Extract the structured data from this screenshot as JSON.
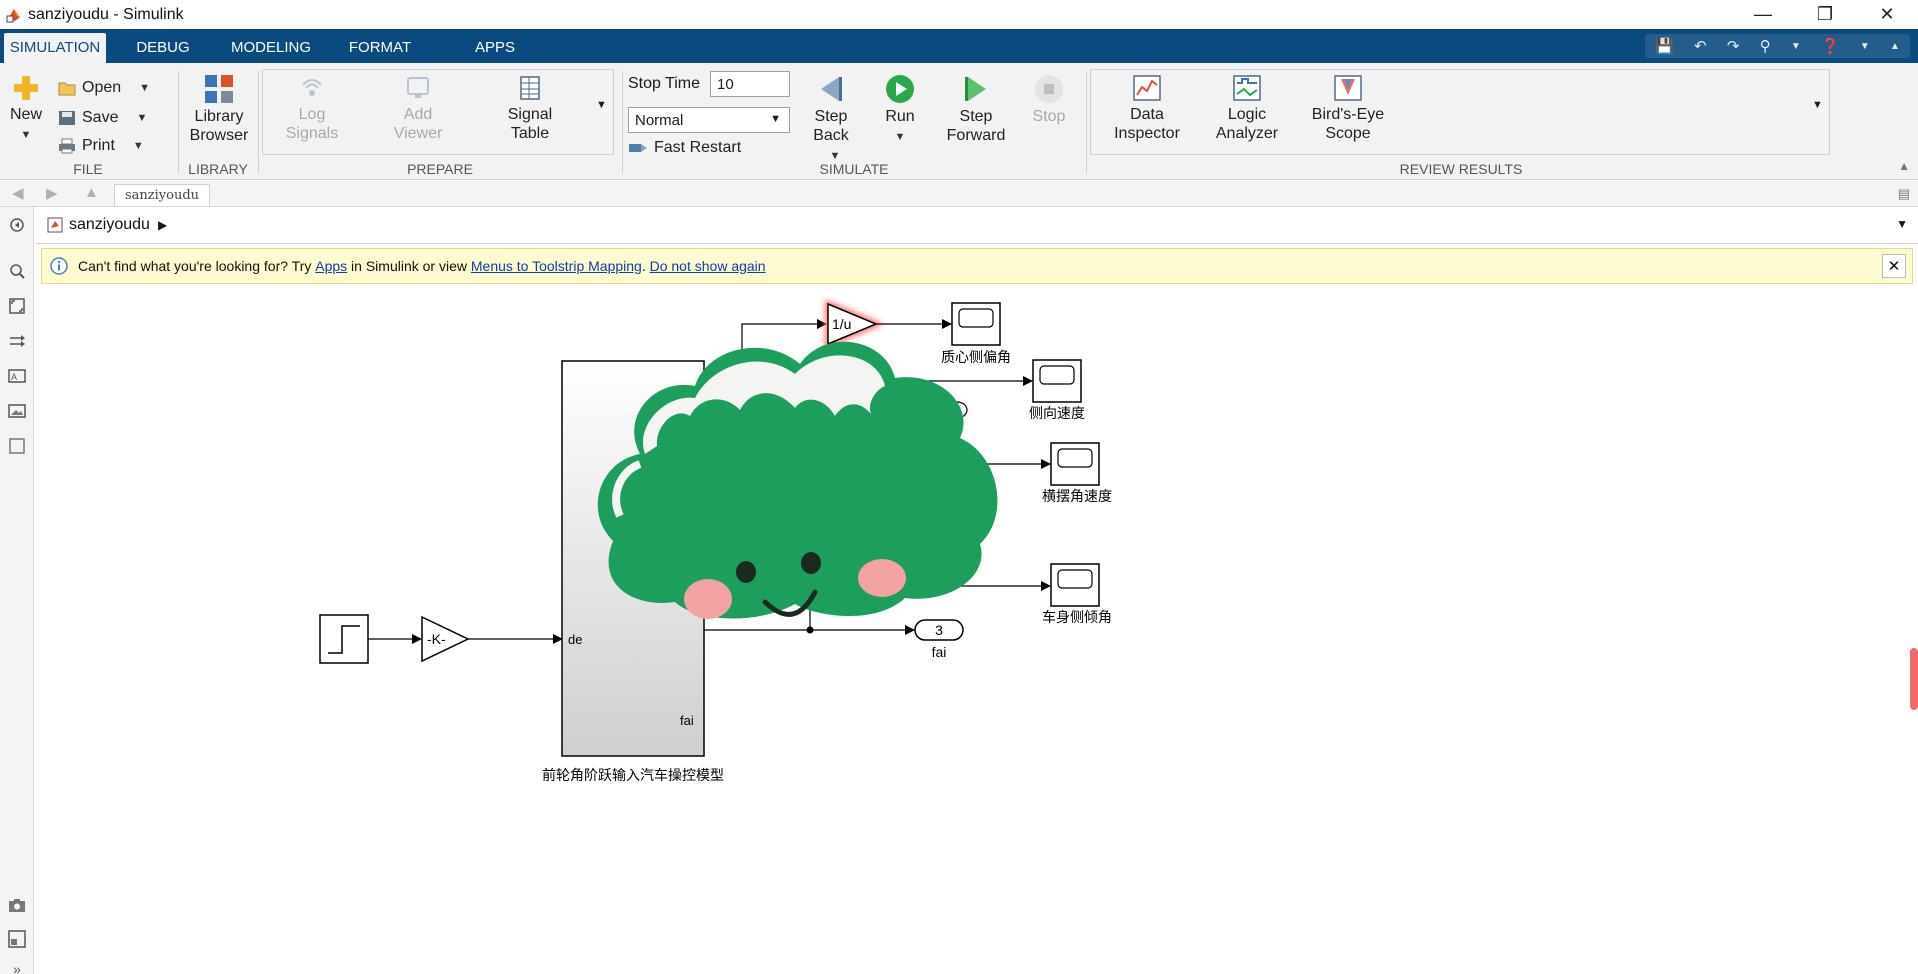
{
  "window": {
    "title": "sanziyoudu - Simulink",
    "controls": {
      "minimize": "—",
      "restore": "❐",
      "close": "✕"
    }
  },
  "tabs": [
    {
      "label": "SIMULATION",
      "active": true
    },
    {
      "label": "DEBUG"
    },
    {
      "label": "MODELING"
    },
    {
      "label": "FORMAT"
    },
    {
      "label": "APPS"
    }
  ],
  "ribbon": {
    "file": {
      "label": "FILE",
      "new_label": "New",
      "open_label": "Open",
      "save_label": "Save",
      "print_label": "Print"
    },
    "library": {
      "label": "LIBRARY",
      "browser_line1": "Library",
      "browser_line2": "Browser"
    },
    "prepare": {
      "label": "PREPARE",
      "log_signals_line1": "Log",
      "log_signals_line2": "Signals",
      "add_viewer_line1": "Add",
      "add_viewer_line2": "Viewer",
      "signal_table_line1": "Signal",
      "signal_table_line2": "Table"
    },
    "simulate": {
      "label": "SIMULATE",
      "stop_time_label": "Stop Time",
      "stop_time_value": "10",
      "mode_value": "Normal",
      "fast_restart_label": "Fast Restart",
      "step_back_line1": "Step",
      "step_back_line2": "Back",
      "run_label": "Run",
      "step_forward_line1": "Step",
      "step_forward_line2": "Forward",
      "stop_label": "Stop"
    },
    "review": {
      "label": "REVIEW RESULTS",
      "data_inspector_line1": "Data",
      "data_inspector_line2": "Inspector",
      "logic_analyzer_line1": "Logic",
      "logic_analyzer_line2": "Analyzer",
      "birds_eye_line1": "Bird's-Eye",
      "birds_eye_line2": "Scope"
    }
  },
  "navbar": {
    "model_tab": "sanziyoudu"
  },
  "breadcrumb": {
    "model": "sanziyoudu"
  },
  "banner": {
    "text1": "Can't find what you're looking for? Try ",
    "link_apps": "Apps",
    "text2": " in Simulink or view ",
    "link_menus": "Menus to Toolstrip Mapping",
    "text3": ". ",
    "link_hide": "Do not show again"
  },
  "diagram": {
    "gain_label": "-K-",
    "reciprocal_label": "1/u",
    "subsystem_input": "de",
    "subsystem_output_fai": "fai",
    "subsystem_name": "前轮角阶跃输入汽车操控模型",
    "outport_number": "3",
    "outport_name": "fai",
    "scope_labels": [
      "质心侧偏角",
      "侧向速度",
      "横摆角速度",
      "车身侧倾角"
    ]
  },
  "colors": {
    "tab_bar": "#0b4a7e",
    "ribbon_bg": "#f2f2f2",
    "banner_bg": "#fffbd0",
    "run_green": "#2aa84a",
    "link": "#0b3fa8",
    "sticker_green": "#1e9e5c",
    "sticker_blush": "#f4a3a3"
  }
}
